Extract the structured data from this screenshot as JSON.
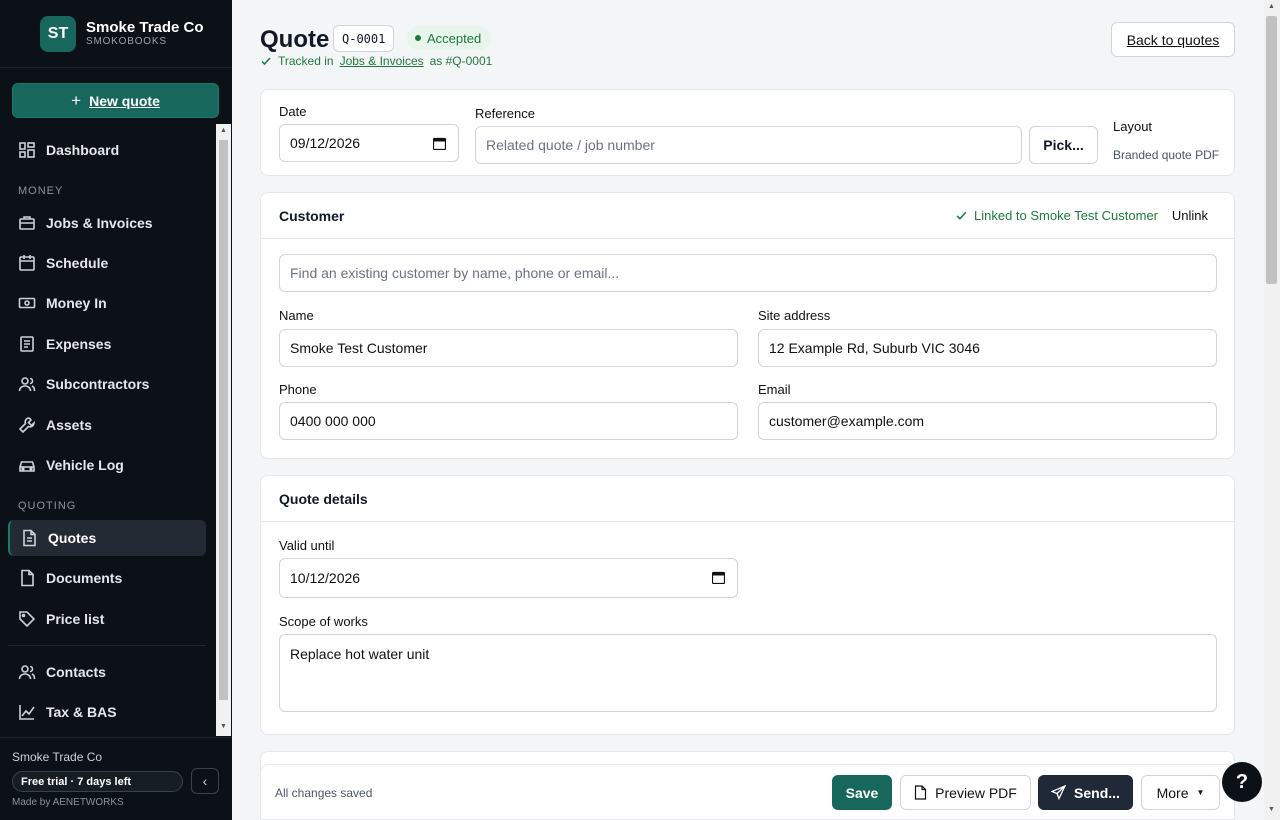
{
  "brand": {
    "initials": "ST",
    "name": "Smoke Trade Co",
    "sub": "SMOKOBOOKS"
  },
  "sidebar": {
    "new_quote": "New quote",
    "items": [
      {
        "label": "Dashboard",
        "icon": "dashboard-icon"
      },
      {
        "label": "Jobs & Invoices",
        "icon": "briefcase-icon"
      },
      {
        "label": "Schedule",
        "icon": "calendar-icon"
      },
      {
        "label": "Money In",
        "icon": "cash-icon"
      },
      {
        "label": "Expenses",
        "icon": "receipt-icon"
      },
      {
        "label": "Subcontractors",
        "icon": "users-icon"
      },
      {
        "label": "Assets",
        "icon": "wrench-icon"
      },
      {
        "label": "Vehicle Log",
        "icon": "car-icon"
      },
      {
        "label": "Quotes",
        "icon": "document-icon",
        "active": true
      },
      {
        "label": "Documents",
        "icon": "file-icon"
      },
      {
        "label": "Price list",
        "icon": "tag-icon"
      },
      {
        "label": "Contacts",
        "icon": "contacts-icon"
      },
      {
        "label": "Tax & BAS",
        "icon": "chart-icon"
      }
    ],
    "sections": {
      "money": "MONEY",
      "quoting": "QUOTING"
    },
    "footer": {
      "org": "Smoke Trade Co",
      "trial": "Free trial · 7 days left",
      "made_by": "Made by AENETWORKS"
    }
  },
  "header": {
    "title": "Quote",
    "number": "Q-0001",
    "status": "Accepted",
    "tracked_prefix": "Tracked in",
    "tracked_link": "Jobs & Invoices",
    "tracked_suffix": "as #Q-0001",
    "back": "Back to quotes"
  },
  "top_card": {
    "date_label": "Date",
    "date_value": "09/12/2026",
    "reference_label": "Reference",
    "reference_placeholder": "Related quote / job number",
    "pick": "Pick...",
    "layout_label": "Layout",
    "layout_value": "Branded quote PDF"
  },
  "customer": {
    "title": "Customer",
    "linked": "Linked to Smoke Test Customer",
    "unlink": "Unlink",
    "search_placeholder": "Find an existing customer by name, phone or email...",
    "name_label": "Name",
    "name_value": "Smoke Test Customer",
    "site_label": "Site address",
    "site_value": "12 Example Rd, Suburb VIC 3046",
    "phone_label": "Phone",
    "phone_value": "0400 000 000",
    "email_label": "Email",
    "email_value": "customer@example.com"
  },
  "details": {
    "title": "Quote details",
    "valid_label": "Valid until",
    "valid_value": "10/12/2026",
    "scope_label": "Scope of works",
    "scope_value": "Replace hot water unit"
  },
  "bottom": {
    "saved": "All changes saved",
    "save": "Save",
    "preview": "Preview PDF",
    "send": "Send...",
    "more": "More"
  },
  "help": "?",
  "colors": {
    "accent": "#17675c",
    "sidebar_bg": "#0c1117",
    "success": "#1e7a3d"
  }
}
